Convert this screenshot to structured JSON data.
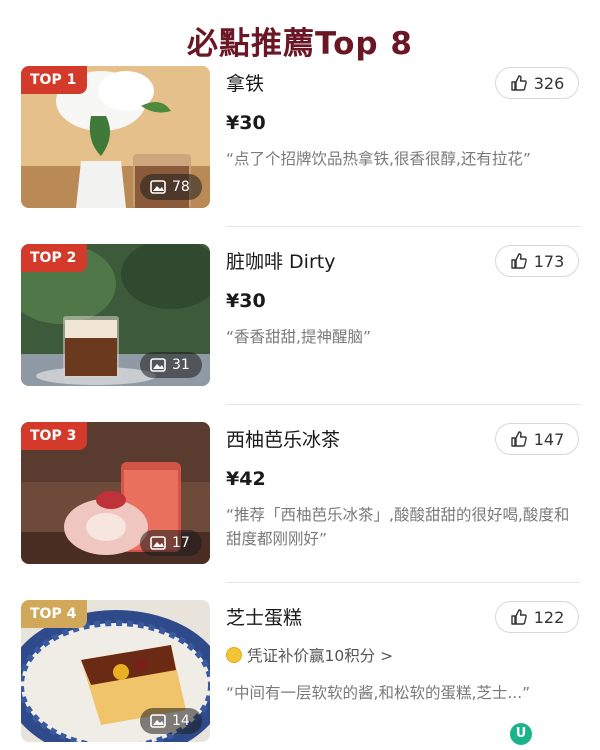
{
  "page": {
    "title": "必點推薦Top 8"
  },
  "items": [
    {
      "rank": "TOP 1",
      "name": "拿铁",
      "price": "¥30",
      "review": "“点了个招牌饮品热拿铁,很香很醇,还有拉花”",
      "likes": "326",
      "photos": "78",
      "badge_color": "#d43a2a"
    },
    {
      "rank": "TOP 2",
      "name": "脏咖啡 Dirty",
      "price": "¥30",
      "review": "“香香甜甜,提神醒脑”",
      "likes": "173",
      "photos": "31",
      "badge_color": "#d43a2a"
    },
    {
      "rank": "TOP 3",
      "name": "西柚芭乐冰茶",
      "price": "¥42",
      "review": "“推荐「西柚芭乐冰茶」,酸酸甜甜的很好喝,酸度和甜度都刚刚好”",
      "likes": "147",
      "photos": "17",
      "badge_color": "#d43a2a"
    },
    {
      "rank": "TOP 4",
      "name": "芝士蛋糕",
      "voucher": "凭证补价赢10积分 >",
      "review": "“中间有一层软软的酱,和松软的蛋糕,芝士...”",
      "likes": "122",
      "photos": "14",
      "badge_color": "#d1a75a"
    }
  ],
  "icons": {
    "like": "thumbs-up-icon",
    "photo": "image-icon",
    "coin": "coin-icon"
  }
}
